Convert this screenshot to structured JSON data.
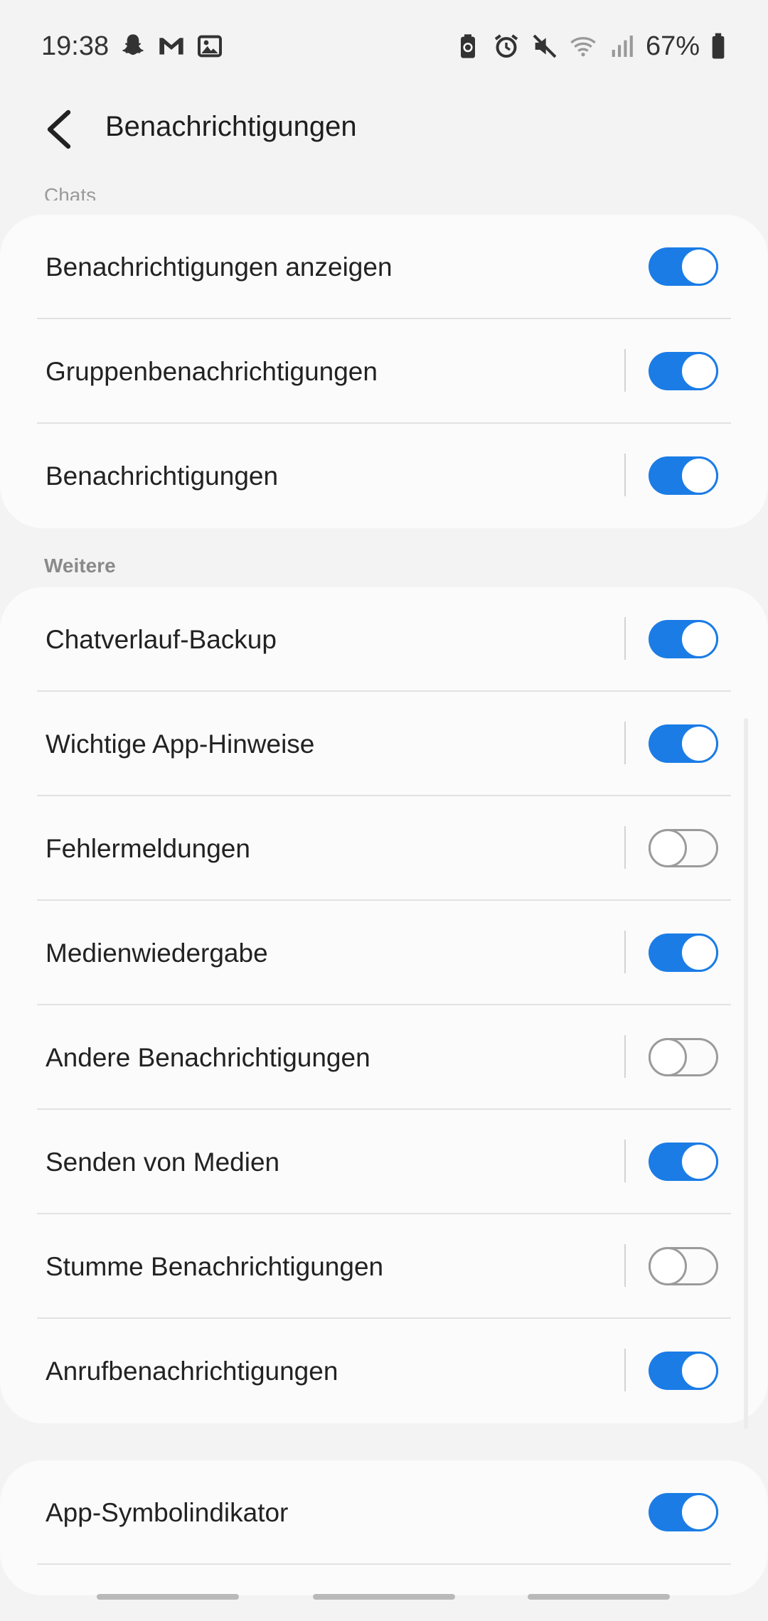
{
  "status_bar": {
    "time": "19:38",
    "left_icons": [
      "snapchat-icon",
      "gmail-icon",
      "gallery-icon"
    ],
    "right_icons": [
      "battery-saver-icon",
      "alarm-icon",
      "mute-icon",
      "wifi-icon",
      "signal-icon"
    ],
    "battery": "67%"
  },
  "app_bar": {
    "title": "Benachrichtigungen"
  },
  "partial_header": "Chats",
  "sections": [
    {
      "label": "",
      "items": [
        {
          "label": "Benachrichtigungen anzeigen",
          "on": true,
          "divider": false
        },
        {
          "label": "Gruppenbenachrichtigungen",
          "on": true,
          "divider": true
        },
        {
          "label": "Benachrichtigungen",
          "on": true,
          "divider": true
        }
      ]
    },
    {
      "label": "Weitere",
      "items": [
        {
          "label": "Chatverlauf-Backup",
          "on": true,
          "divider": true
        },
        {
          "label": "Wichtige App-Hinweise",
          "on": true,
          "divider": true
        },
        {
          "label": "Fehlermeldungen",
          "on": false,
          "divider": true
        },
        {
          "label": "Medienwiedergabe",
          "on": true,
          "divider": true
        },
        {
          "label": "Andere Benachrichtigungen",
          "on": false,
          "divider": true
        },
        {
          "label": "Senden von Medien",
          "on": true,
          "divider": true
        },
        {
          "label": "Stumme Benachrichtigungen",
          "on": false,
          "divider": true
        },
        {
          "label": "Anrufbenachrichtigungen",
          "on": true,
          "divider": true
        }
      ]
    },
    {
      "label": "",
      "items": [
        {
          "label": "App-Symbolindikator",
          "on": true,
          "divider": false
        }
      ]
    }
  ],
  "colors": {
    "accent": "#1b7ce6",
    "background": "#f3f3f3",
    "card": "#fbfbfb"
  }
}
